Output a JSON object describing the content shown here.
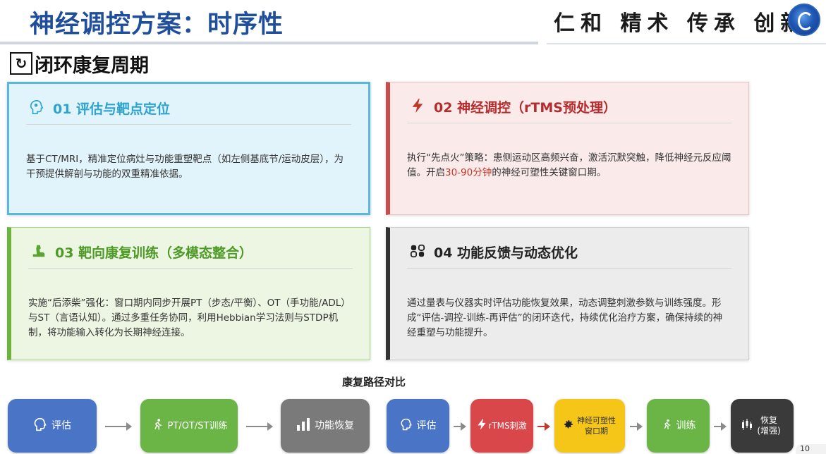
{
  "header": {
    "title": "神经调控方案：时序性",
    "slogan": "仁和 精术 传承 创新"
  },
  "section": {
    "title": "闭环康复周期"
  },
  "cards": [
    {
      "title": "01 评估与靶点定位",
      "icon": "brain-head-icon",
      "body": "基于CT/MRI，精准定位病灶与功能重塑靶点（如左侧基底节/运动皮层），为干预提供解剖与功能的双重精准依据。"
    },
    {
      "title": "02 神经调控（rTMS预处理）",
      "icon": "lightning-icon",
      "body_prefix": "执行“先点火”策略：患侧运动区高频兴奋，激活沉默突触，降低神经元反应阈值。开启",
      "body_highlight": "30-90分钟",
      "body_suffix": "的神经可塑性关键窗口期。"
    },
    {
      "title": "03 靶向康复训练（多模态整合）",
      "icon": "flexed-arm-icon",
      "body": "实施“后添柴”强化：窗口期内同步开展PT（步态/平衡）、OT（手功能/ADL）与ST（言语认知）。通过多重任务协同，利用Hebbian学习法则与STDP机制，将功能输入转化为长期神经连接。"
    },
    {
      "title": "04 功能反馈与动态优化",
      "icon": "feedback-toggle-icon",
      "body": "通过量表与仪器实时评估功能恢复效果，动态调整刺激参数与训练强度。形成“评估-调控-训练-再评估”的闭环迭代，持续优化治疗方案，确保持续的神经重塑与功能提升。"
    }
  ],
  "flow": {
    "title": "康复路径对比",
    "traditional": [
      {
        "label": "评估",
        "icon": "brain-head-icon"
      },
      {
        "label": "PT/OT/ST训练",
        "icon": "running-person-icon"
      },
      {
        "label": "功能恢复",
        "icon": "bar-chart-icon"
      }
    ],
    "new": [
      {
        "label": "评估",
        "icon": "brain-head-icon"
      },
      {
        "label": "rTMS刺激",
        "icon": "lightning-icon"
      },
      {
        "label": "神经可塑性窗口期",
        "icon": "gear-icon"
      },
      {
        "label": "训练",
        "icon": "running-person-icon"
      },
      {
        "label": "恢复(增强)",
        "icon": "candlestick-chart-icon"
      }
    ]
  },
  "page_number": "10",
  "colors": {
    "title": "#1f4e9c",
    "card1": "#5ab8dc",
    "card2": "#c94c4c",
    "card3": "#6db33f",
    "card4": "#333333",
    "highlight": "#c0392b"
  }
}
